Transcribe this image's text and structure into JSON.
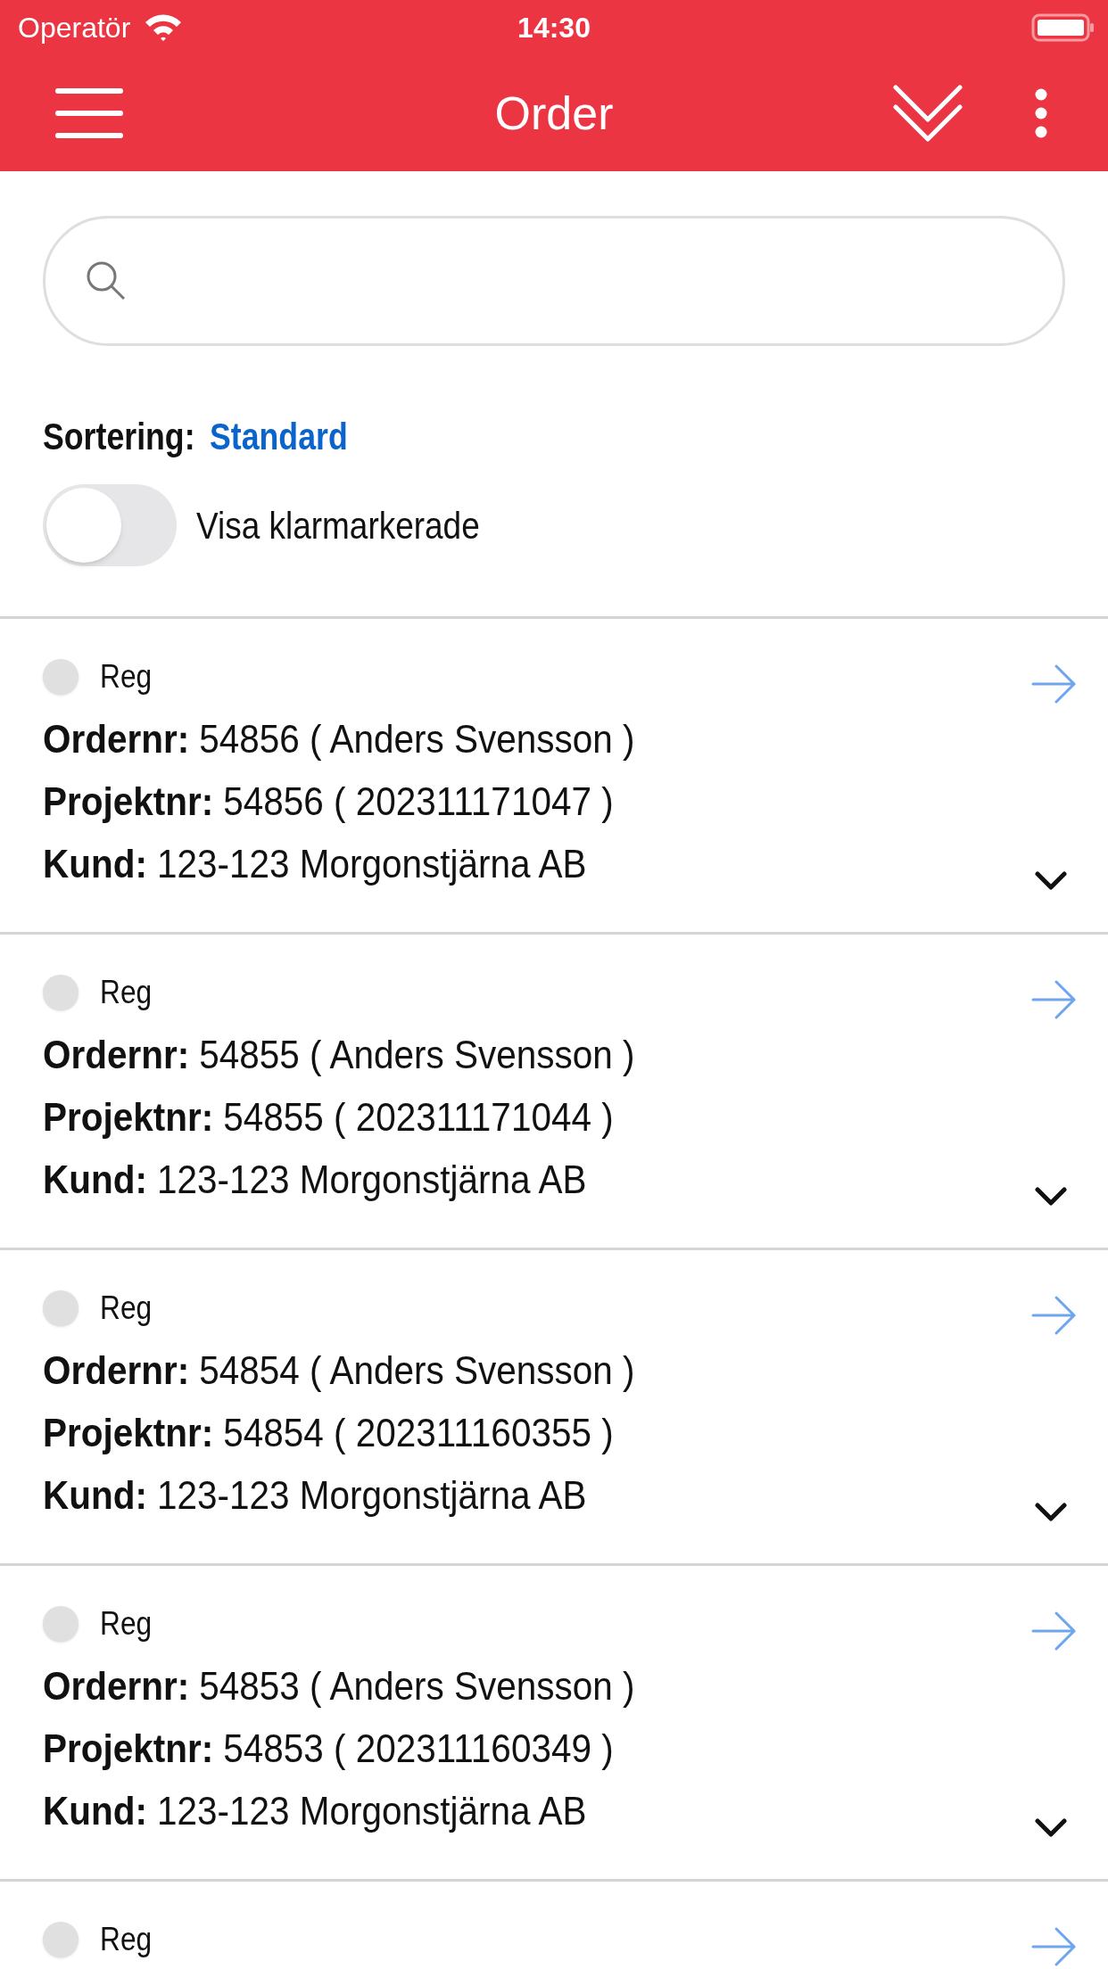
{
  "status_bar": {
    "carrier": "Operatör",
    "time": "14:30"
  },
  "header": {
    "title": "Order"
  },
  "sorting": {
    "label": "Sortering:",
    "value": "Standard"
  },
  "toggle": {
    "label": "Visa klarmarkerade",
    "on": false
  },
  "orders": [
    {
      "checked": false,
      "status": "Reg",
      "order_label": "Ordernr:",
      "order": "54856 ( Anders Svensson )",
      "project_label": "Projektnr:",
      "project": "54856 ( 202311171047 )",
      "customer_label": "Kund:",
      "customer": "123-123 Morgonstjärna AB"
    },
    {
      "checked": false,
      "status": "Reg",
      "order_label": "Ordernr:",
      "order": "54855 ( Anders Svensson )",
      "project_label": "Projektnr:",
      "project": "54855 ( 202311171044 )",
      "customer_label": "Kund:",
      "customer": "123-123 Morgonstjärna AB"
    },
    {
      "checked": false,
      "status": "Reg",
      "order_label": "Ordernr:",
      "order": "54854 ( Anders Svensson )",
      "project_label": "Projektnr:",
      "project": "54854 ( 202311160355 )",
      "customer_label": "Kund:",
      "customer": "123-123 Morgonstjärna AB"
    },
    {
      "checked": false,
      "status": "Reg",
      "order_label": "Ordernr:",
      "order": "54853 ( Anders Svensson )",
      "project_label": "Projektnr:",
      "project": "54853 ( 202311160349 )",
      "customer_label": "Kund:",
      "customer": "123-123 Morgonstjärna AB"
    },
    {
      "checked": false,
      "status": "Reg"
    }
  ]
}
